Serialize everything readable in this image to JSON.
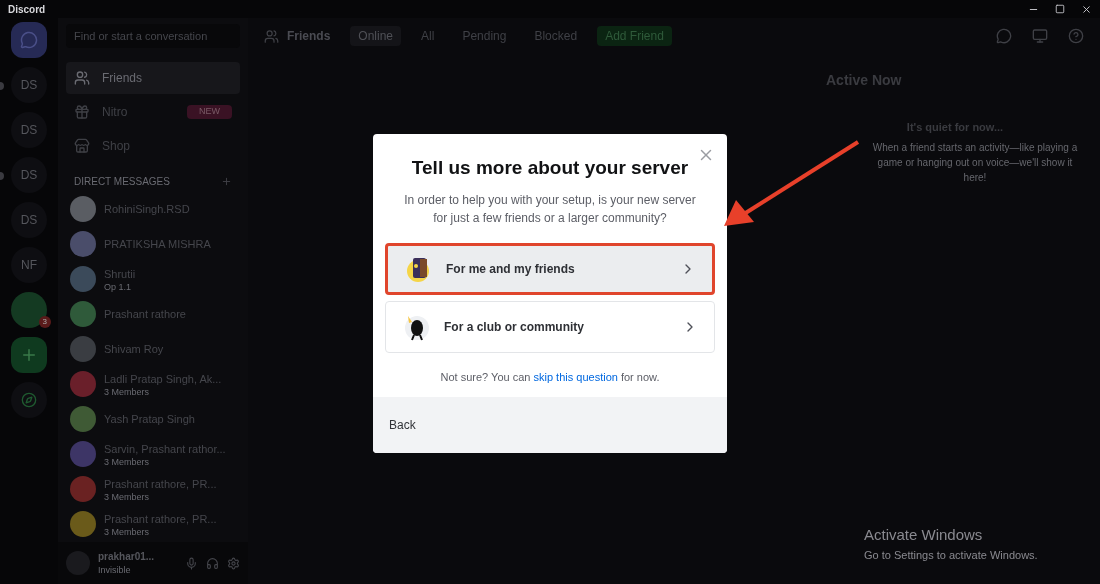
{
  "window": {
    "title": "Discord"
  },
  "servers": [
    {
      "label": "DS",
      "unread": true
    },
    {
      "label": "DS",
      "unread": false
    },
    {
      "label": "DS",
      "unread": true
    },
    {
      "label": "DS",
      "unread": false
    },
    {
      "label": "NF",
      "unread": false
    }
  ],
  "server_badge": "3",
  "search": {
    "placeholder": "Find or start a conversation"
  },
  "nav": [
    {
      "label": "Friends",
      "selected": true,
      "kind": "friends"
    },
    {
      "label": "Nitro",
      "selected": false,
      "kind": "nitro",
      "badge": "NEW"
    },
    {
      "label": "Shop",
      "selected": false,
      "kind": "shop"
    }
  ],
  "dm_header": "DIRECT MESSAGES",
  "dms": [
    {
      "name": "RohiniSingh.RSD",
      "color": "#5a5d63"
    },
    {
      "name": "PRATIKSHA MISHRA",
      "color": "#4a4d6a"
    },
    {
      "name": "Shrutii",
      "color": "#3b4a5a",
      "sub": "Op 1.1"
    },
    {
      "name": "Prashant rathore",
      "color": "#2f5a3a"
    },
    {
      "name": "Shivam Roy",
      "color": "#3a3d42"
    },
    {
      "name": "Ladli Pratap Singh, Ak...",
      "color": "#6a1f2a",
      "sub": "3 Members"
    },
    {
      "name": "Yash Pratap Singh",
      "color": "#3f5a35"
    },
    {
      "name": "Sarvin, Prashant rathor...",
      "color": "#3d3566",
      "sub": "3 Members"
    },
    {
      "name": "Prashant rathore, PR...",
      "color": "#6a2222",
      "sub": "3 Members"
    },
    {
      "name": "Prashant rathore, PR...",
      "color": "#6a5a1a",
      "sub": "3 Members"
    }
  ],
  "user": {
    "name": "prakhar01...",
    "status": "Invisible"
  },
  "tabs": [
    {
      "label": "Friends",
      "kind": "title",
      "selected": false
    },
    {
      "label": "Online",
      "kind": "tab",
      "selected": true
    },
    {
      "label": "All",
      "kind": "tab",
      "selected": false
    },
    {
      "label": "Pending",
      "kind": "tab",
      "selected": false
    },
    {
      "label": "Blocked",
      "kind": "tab",
      "selected": false
    },
    {
      "label": "Add Friend",
      "kind": "add",
      "selected": false
    }
  ],
  "active_now": {
    "title": "Active Now",
    "empty_title": "It's quiet for now...",
    "empty_text": "When a friend starts an activity—like playing a game or hanging out on voice—we'll show it here!"
  },
  "modal": {
    "title": "Tell us more about your server",
    "subtitle": "In order to help you with your setup, is your new server for just a few friends or a larger community?",
    "options": [
      {
        "label": "For me and my friends",
        "highlighted": true,
        "kind": "friends"
      },
      {
        "label": "For a club or community",
        "highlighted": false,
        "kind": "club"
      }
    ],
    "footnote": {
      "before": "Not sure? You can ",
      "link": "skip this question",
      "after": " for now."
    },
    "back": "Back"
  },
  "watermark": {
    "title": "Activate Windows",
    "text": "Go to Settings to activate Windows."
  }
}
